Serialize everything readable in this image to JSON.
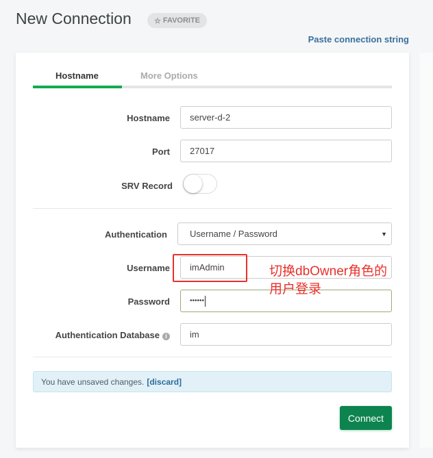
{
  "header": {
    "title": "New Connection",
    "favorite": "FAVORITE",
    "paste": "Paste connection string"
  },
  "tabs": [
    {
      "label": "Hostname",
      "active": true
    },
    {
      "label": "More Options",
      "active": false
    }
  ],
  "form": {
    "hostname": {
      "label": "Hostname",
      "value": "server-d-2"
    },
    "port": {
      "label": "Port",
      "value": "27017"
    },
    "srv": {
      "label": "SRV Record",
      "on": false
    },
    "auth": {
      "label": "Authentication",
      "value": "Username / Password"
    },
    "username": {
      "label": "Username",
      "value": "imAdmin"
    },
    "password": {
      "label": "Password",
      "value": "••••••"
    },
    "authdb": {
      "label": "Authentication Database",
      "value": "im"
    }
  },
  "alert": {
    "text": "You have unsaved changes.",
    "discard": "[discard]"
  },
  "connect": "Connect",
  "annotation": {
    "line1": "切换dbOwner角色的",
    "line2": "用户登录",
    "color": "#e8302a"
  },
  "colors": {
    "accent": "#13aa52",
    "button": "#0d8450",
    "link": "#3a6f9e"
  }
}
